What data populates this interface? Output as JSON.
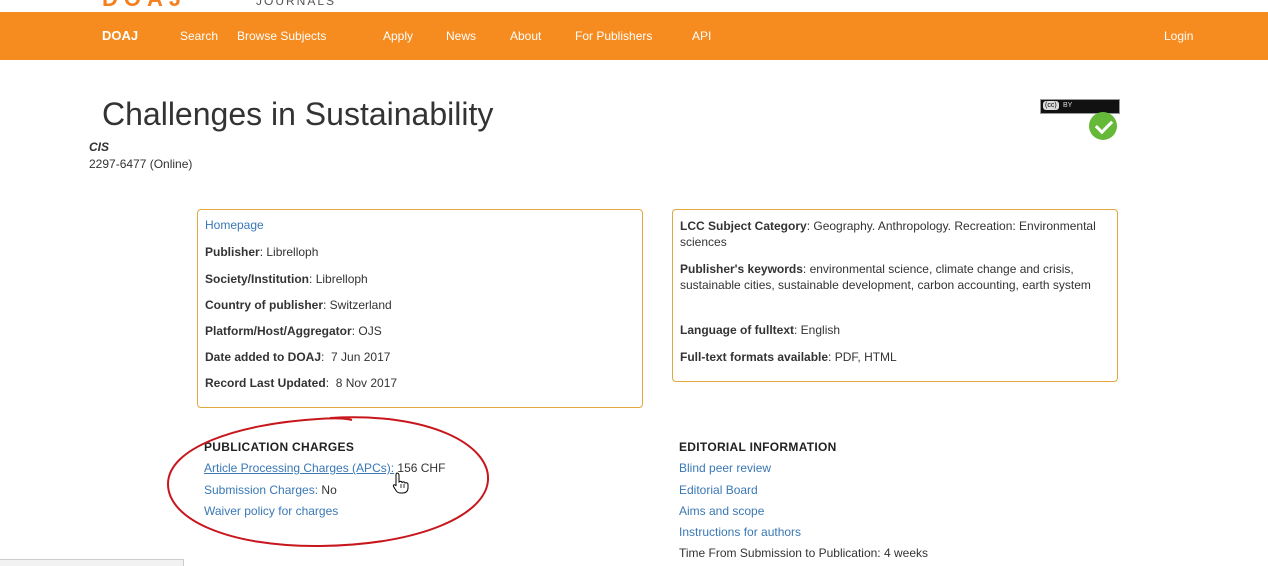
{
  "logo": {
    "mark": "DOAJ",
    "word": "JOURNALS"
  },
  "nav": {
    "brand": "DOAJ",
    "items": [
      "Search",
      "Browse Subjects",
      "Apply",
      "News",
      "About",
      "For Publishers",
      "API"
    ],
    "login": "Login"
  },
  "journal": {
    "title": "Challenges in Sustainability",
    "abbreviation": "CIS",
    "issn": "2297-6477 (Online)",
    "license": {
      "cc": "(cc)",
      "by": "BY"
    }
  },
  "details_left": {
    "homepage": "Homepage",
    "fields": [
      {
        "label": "Publisher",
        "value": " Librelloph"
      },
      {
        "label": "Society/Institution",
        "value": " Librelloph"
      },
      {
        "label": "Country of publisher",
        "value": " Switzerland"
      },
      {
        "label": "Platform/Host/Aggregator",
        "value": " OJS"
      },
      {
        "label": "Date added to DOAJ",
        "value": "  7 Jun 2017"
      },
      {
        "label": "Record Last Updated",
        "value": "  8 Nov 2017"
      }
    ]
  },
  "details_right": {
    "fields": [
      {
        "label": "LCC Subject Category",
        "value": " Geography. Anthropology. Recreation: Environmental sciences"
      },
      {
        "label": "Publisher's keywords",
        "value": " environmental science, climate change and crisis, sustainable cities, sustainable development, carbon accounting, earth system"
      },
      {
        "label": "Language of fulltext",
        "value": " English"
      },
      {
        "label": "Full-text formats available",
        "value": " PDF, HTML"
      }
    ]
  },
  "publication_charges": {
    "heading": "PUBLICATION CHARGES",
    "apc_link": "Article Processing Charges (APCs):",
    "apc_value": " 156 CHF",
    "submission_link": "Submission Charges:",
    "submission_value": " No",
    "waiver_link": "Waiver policy for charges"
  },
  "editorial": {
    "heading": "EDITORIAL INFORMATION",
    "links": [
      "Blind peer review",
      "Editorial Board",
      "Aims and scope",
      "Instructions for authors"
    ],
    "time_label": "Time From Submission to Publication:",
    "time_value": " 4 weeks"
  },
  "colors": {
    "nav_bg": "#f68b1f",
    "panel_border": "#e2a73f",
    "link": "#3a78b5",
    "annotation": "#c8161d",
    "seal": "#66b839"
  }
}
